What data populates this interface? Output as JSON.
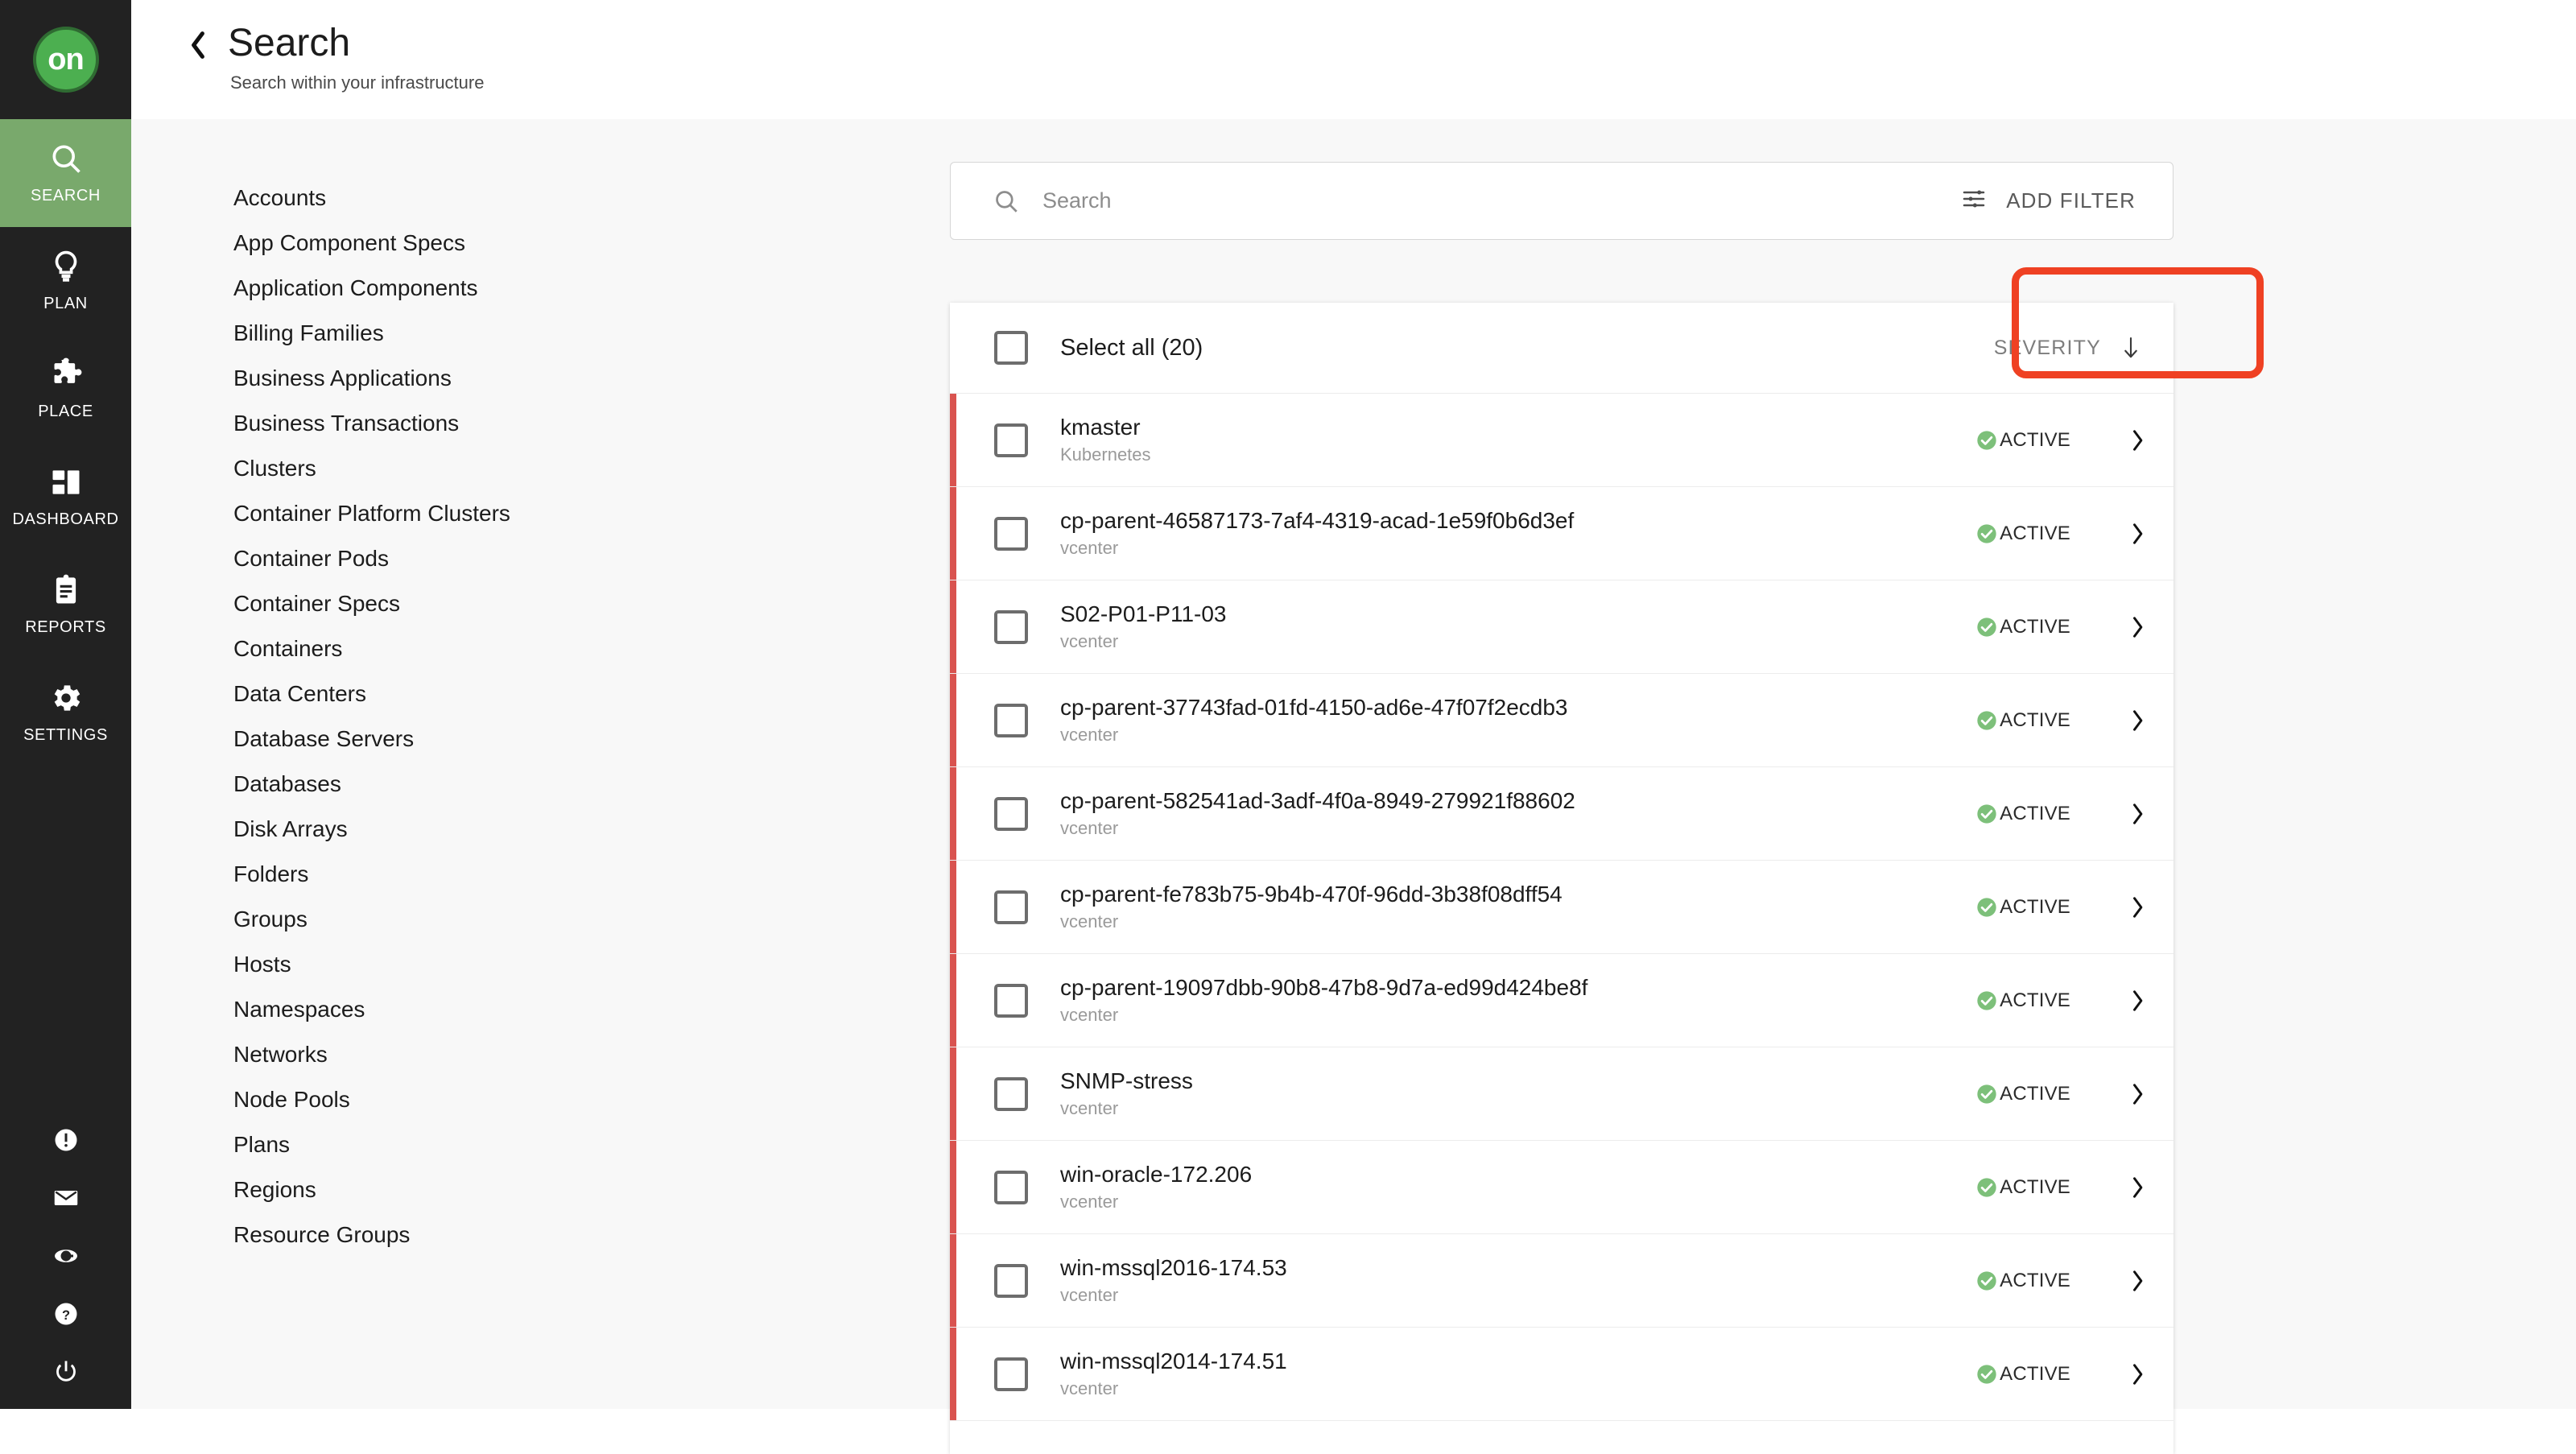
{
  "rail": {
    "logo_text": "on",
    "items": [
      {
        "label": "SEARCH",
        "icon": "magnifier-icon",
        "active": true
      },
      {
        "label": "PLAN",
        "icon": "lightbulb-icon",
        "active": false
      },
      {
        "label": "PLACE",
        "icon": "puzzle-icon",
        "active": false
      },
      {
        "label": "DASHBOARD",
        "icon": "grid-icon",
        "active": false
      },
      {
        "label": "REPORTS",
        "icon": "clipboard-icon",
        "active": false
      },
      {
        "label": "SETTINGS",
        "icon": "gear-icon",
        "active": false
      }
    ],
    "bottom_icons": [
      "alert-icon",
      "mail-icon",
      "globe-icon",
      "help-icon",
      "power-icon"
    ]
  },
  "header": {
    "back_icon": "back-chevron-icon",
    "title": "Search",
    "subtitle": "Search within your infrastructure"
  },
  "categories": {
    "items": [
      "Accounts",
      "App Component Specs",
      "Application Components",
      "Billing Families",
      "Business Applications",
      "Business Transactions",
      "Clusters",
      "Container Platform Clusters",
      "Container Pods",
      "Container Specs",
      "Containers",
      "Data Centers",
      "Database Servers",
      "Databases",
      "Disk Arrays",
      "Folders",
      "Groups",
      "Hosts",
      "Namespaces",
      "Networks",
      "Node Pools",
      "Plans",
      "Regions",
      "Resource Groups"
    ]
  },
  "search": {
    "placeholder": "Search",
    "value": "",
    "icon": "search-icon",
    "add_filter_label": "ADD FILTER",
    "add_filter_icon": "filter-sliders-icon",
    "highlight_color": "#ef4123"
  },
  "results": {
    "select_all_label": "Select all (20)",
    "sort_column": "SEVERITY",
    "sort_direction_icon": "arrow-down-icon",
    "accent_color": "#d9534f",
    "status_color": "#7dc07a",
    "rows": [
      {
        "name": "kmaster",
        "source": "Kubernetes",
        "status": "ACTIVE"
      },
      {
        "name": "cp-parent-46587173-7af4-4319-acad-1e59f0b6d3ef",
        "source": "vcenter",
        "status": "ACTIVE"
      },
      {
        "name": "S02-P01-P11-03",
        "source": "vcenter",
        "status": "ACTIVE"
      },
      {
        "name": "cp-parent-37743fad-01fd-4150-ad6e-47f07f2ecdb3",
        "source": "vcenter",
        "status": "ACTIVE"
      },
      {
        "name": "cp-parent-582541ad-3adf-4f0a-8949-279921f88602",
        "source": "vcenter",
        "status": "ACTIVE"
      },
      {
        "name": "cp-parent-fe783b75-9b4b-470f-96dd-3b38f08dff54",
        "source": "vcenter",
        "status": "ACTIVE"
      },
      {
        "name": "cp-parent-19097dbb-90b8-47b8-9d7a-ed99d424be8f",
        "source": "vcenter",
        "status": "ACTIVE"
      },
      {
        "name": "SNMP-stress",
        "source": "vcenter",
        "status": "ACTIVE"
      },
      {
        "name": "win-oracle-172.206",
        "source": "vcenter",
        "status": "ACTIVE"
      },
      {
        "name": "win-mssql2016-174.53",
        "source": "vcenter",
        "status": "ACTIVE"
      },
      {
        "name": "win-mssql2014-174.51",
        "source": "vcenter",
        "status": "ACTIVE"
      }
    ]
  }
}
